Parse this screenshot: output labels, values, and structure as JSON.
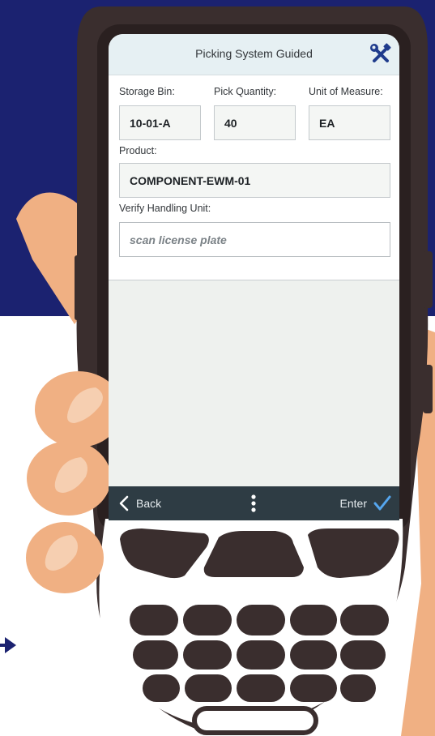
{
  "app": {
    "title": "Picking System Guided"
  },
  "form": {
    "storage_bin": {
      "label": "Storage Bin:",
      "value": "10-01-A"
    },
    "pick_quantity": {
      "label": "Pick Quantity:",
      "value": "40"
    },
    "unit_of_measure": {
      "label": "Unit of Measure:",
      "value": "EA"
    },
    "product": {
      "label": "Product:",
      "value": "COMPONENT-EWM-01"
    },
    "verify_hu": {
      "label": "Verify Handling Unit:",
      "placeholder": "scan license plate",
      "value": ""
    }
  },
  "footer": {
    "back_label": "Back",
    "enter_label": "Enter"
  },
  "colors": {
    "background_top": "#1b2270",
    "device_body": "#3a2e2e",
    "screen_header": "#e6f0f3",
    "footer_bar": "#2e3c44",
    "accent_blue": "#1b2270",
    "check_blue": "#55a6ee",
    "hand": "#f0b083"
  },
  "icons": {
    "tools": "wrench-screwdriver-icon",
    "back": "chevron-left-icon",
    "more": "vertical-dots-icon",
    "enter": "checkmark-icon",
    "arrow": "arrow-right-icon"
  }
}
